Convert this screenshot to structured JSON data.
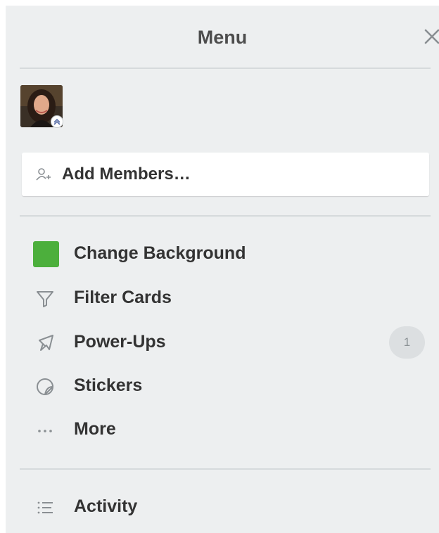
{
  "panel": {
    "title": "Menu",
    "background_color": "#edeff0"
  },
  "header": {
    "close_icon": "close-icon"
  },
  "members": {
    "avatar_icon": "avatar-photo",
    "badge_icon": "admin-chevrons-icon",
    "add_members_label": "Add Members…",
    "add_members_icon": "add-person-icon"
  },
  "menu": {
    "items": [
      {
        "label": "Change Background",
        "icon": "color-swatch",
        "swatch_color": "#4caf3c"
      },
      {
        "label": "Filter Cards",
        "icon": "filter-icon"
      },
      {
        "label": "Power-Ups",
        "icon": "rocket-icon",
        "badge": "1"
      },
      {
        "label": "Stickers",
        "icon": "sticker-icon"
      },
      {
        "label": "More",
        "icon": "more-dots-icon"
      }
    ]
  },
  "activity": {
    "label": "Activity",
    "icon": "list-icon"
  }
}
